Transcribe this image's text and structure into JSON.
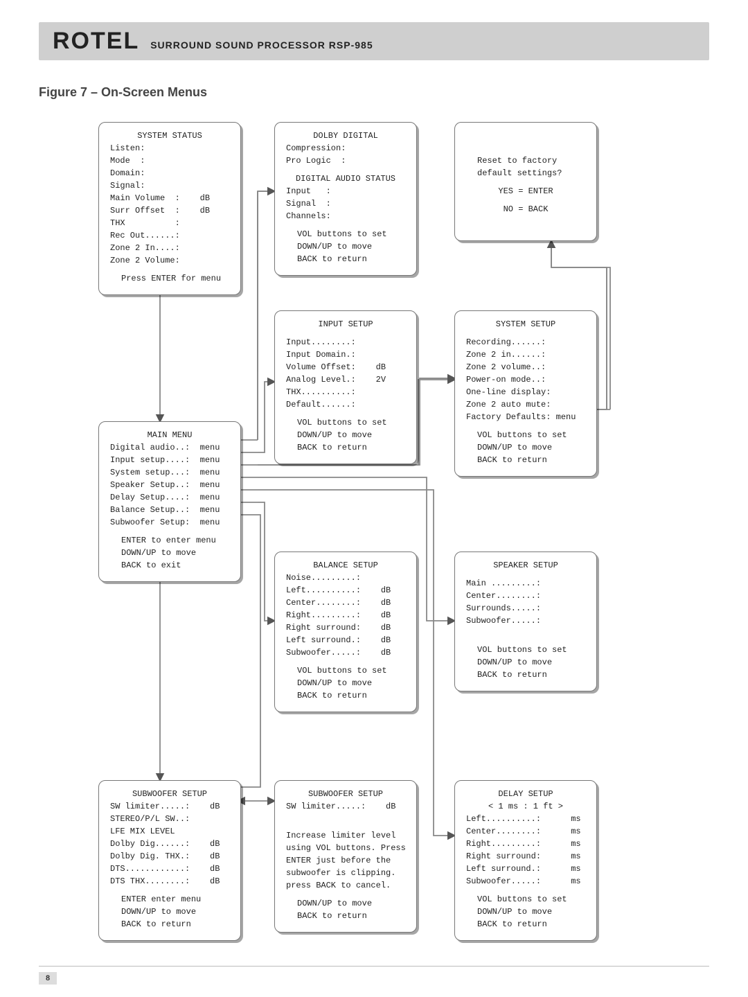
{
  "header": {
    "brand": "ROTEL",
    "product": "SURROUND SOUND PROCESSOR  RSP-985"
  },
  "figure_title": "Figure 7 – On-Screen Menus",
  "page_number": "8",
  "system_status": {
    "title": "SYSTEM STATUS",
    "r1": "Listen:",
    "r2": "Mode  :",
    "r3": "Domain:",
    "r4": "Signal:",
    "r5": "Main Volume  :    dB",
    "r6": "Surr Offset  :    dB",
    "r7": "THX          :",
    "r8": "Rec Out......:",
    "r9": "Zone 2 In....:",
    "r10": "Zone 2 Volume:",
    "hint": "Press ENTER for menu"
  },
  "dolby": {
    "title": "DOLBY DIGITAL",
    "r1": "Compression:",
    "r2": "Pro Logic  :",
    "sub": "DIGITAL AUDIO STATUS",
    "r3": "Input   :",
    "r4": "Signal  :",
    "r5": "Channels:",
    "h1": "VOL buttons to set",
    "h2": "DOWN/UP to move",
    "h3": "BACK to return"
  },
  "reset": {
    "r1": "Reset to factory",
    "r2": "default settings?",
    "r3": "YES = ENTER",
    "r4": "NO = BACK"
  },
  "input_setup": {
    "title": "INPUT SETUP",
    "r1": "Input........:",
    "r2": "Input Domain.:",
    "r3": "Volume Offset:    dB",
    "r4": "Analog Level.:    2V",
    "r5": "THX..........:",
    "r6": "Default......:",
    "h1": "VOL buttons to set",
    "h2": "DOWN/UP to move",
    "h3": "BACK to return"
  },
  "system_setup": {
    "title": "SYSTEM SETUP",
    "r1": "Recording......:",
    "r2": "Zone 2 in......:",
    "r3": "Zone 2 volume..:",
    "r4": "Power-on mode..:",
    "r5": "One-line display:",
    "r6": "Zone 2 auto mute:",
    "r7": "Factory Defaults: menu",
    "h1": "VOL buttons to set",
    "h2": "DOWN/UP to move",
    "h3": "BACK to return"
  },
  "main_menu": {
    "title": "MAIN MENU",
    "r1": "Digital audio..:  menu",
    "r2": "Input setup....:  menu",
    "r3": "System setup...:  menu",
    "r4": "Speaker Setup..:  menu",
    "r5": "Delay Setup....:  menu",
    "r6": "Balance Setup..:  menu",
    "r7": "Subwoofer Setup:  menu",
    "h1": "ENTER to enter menu",
    "h2": "DOWN/UP to move",
    "h3": "BACK to exit"
  },
  "balance": {
    "title": "BALANCE SETUP",
    "r1": "Noise.........:",
    "r2": "Left..........:    dB",
    "r3": "Center........:    dB",
    "r4": "Right.........:    dB",
    "r5": "Right surround:    dB",
    "r6": "Left surround.:    dB",
    "r7": "Subwoofer.....:    dB",
    "h1": "VOL buttons to set",
    "h2": "DOWN/UP to move",
    "h3": "BACK to return"
  },
  "speaker": {
    "title": "SPEAKER SETUP",
    "r1": "Main .........:",
    "r2": "Center........:",
    "r3": "Surrounds.....:",
    "r4": "Subwoofer.....:",
    "h1": "VOL buttons to set",
    "h2": "DOWN/UP to move",
    "h3": "BACK to return"
  },
  "sub1": {
    "title": "SUBWOOFER SETUP",
    "r1": "SW limiter.....:    dB",
    "r2": "STEREO/P/L SW..:",
    "r3": "LFE MIX LEVEL",
    "r4": "Dolby Dig......:    dB",
    "r5": "Dolby Dig. THX.:    dB",
    "r6": "DTS............:    dB",
    "r7": "DTS THX........:    dB",
    "h1": "ENTER enter menu",
    "h2": "DOWN/UP to move",
    "h3": "BACK to return"
  },
  "sub2": {
    "title": "SUBWOOFER SETUP",
    "r1": "SW limiter.....:    dB",
    "n1": "Increase limiter level",
    "n2": "using VOL buttons. Press",
    "n3": "ENTER just before the",
    "n4": "subwoofer is clipping.",
    "n5": "press BACK to cancel.",
    "h1": "DOWN/UP to move",
    "h2": "BACK to return"
  },
  "delay": {
    "title": "DELAY SETUP",
    "r0": "< 1 ms : 1 ft >",
    "r1": "Left..........:      ms",
    "r2": "Center........:      ms",
    "r3": "Right.........:      ms",
    "r4": "Right surround:      ms",
    "r5": "Left surround.:      ms",
    "r6": "Subwoofer.....:      ms",
    "h1": "VOL buttons to set",
    "h2": "DOWN/UP to move",
    "h3": "BACK to return"
  }
}
